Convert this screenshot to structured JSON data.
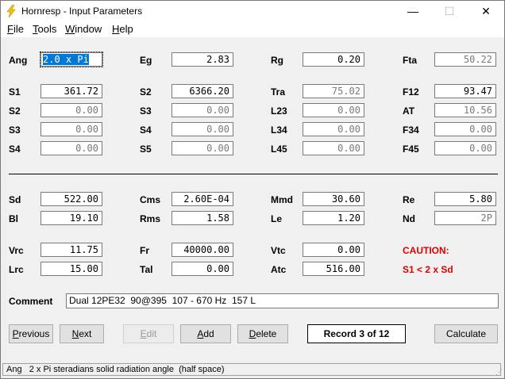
{
  "window": {
    "title": "Hornresp - Input Parameters",
    "icon": "lightning-bolt-icon",
    "controls": {
      "minimize": "—",
      "maximize": "☐",
      "close": "✕"
    }
  },
  "menu": {
    "file_first": "F",
    "file_rest": "ile",
    "tools_first": "T",
    "tools_rest": "ools",
    "window_first": "W",
    "window_rest": "indow",
    "help_first": "H",
    "help_rest": "elp"
  },
  "params": {
    "Ang": {
      "label": "Ang",
      "value": "2.0 x Pi"
    },
    "Eg": {
      "label": "Eg",
      "value": "2.83"
    },
    "Rg": {
      "label": "Rg",
      "value": "0.20"
    },
    "Fta": {
      "label": "Fta",
      "value": "50.22"
    },
    "S1": {
      "label": "S1",
      "value": "361.72"
    },
    "S2": {
      "label": "S2",
      "value": "6366.20"
    },
    "Tra": {
      "label": "Tra",
      "value": "75.02"
    },
    "F12": {
      "label": "F12",
      "value": "93.47"
    },
    "S2b": {
      "label": "S2",
      "value": "0.00"
    },
    "S3": {
      "label": "S3",
      "value": "0.00"
    },
    "L23": {
      "label": "L23",
      "value": "0.00"
    },
    "AT": {
      "label": "AT",
      "value": "10.56"
    },
    "S3b": {
      "label": "S3",
      "value": "0.00"
    },
    "S4": {
      "label": "S4",
      "value": "0.00"
    },
    "L34": {
      "label": "L34",
      "value": "0.00"
    },
    "F34": {
      "label": "F34",
      "value": "0.00"
    },
    "S4b": {
      "label": "S4",
      "value": "0.00"
    },
    "S5": {
      "label": "S5",
      "value": "0.00"
    },
    "L45": {
      "label": "L45",
      "value": "0.00"
    },
    "F45": {
      "label": "F45",
      "value": "0.00"
    },
    "Sd": {
      "label": "Sd",
      "value": "522.00"
    },
    "Cms": {
      "label": "Cms",
      "value": "2.60E-04"
    },
    "Mmd": {
      "label": "Mmd",
      "value": "30.60"
    },
    "Re": {
      "label": "Re",
      "value": "5.80"
    },
    "Bl": {
      "label": "Bl",
      "value": "19.10"
    },
    "Rms": {
      "label": "Rms",
      "value": "1.58"
    },
    "Le": {
      "label": "Le",
      "value": "1.20"
    },
    "Nd": {
      "label": "Nd",
      "value": "2P"
    },
    "Vrc": {
      "label": "Vrc",
      "value": "11.75"
    },
    "Fr": {
      "label": "Fr",
      "value": "40000.00"
    },
    "Vtc": {
      "label": "Vtc",
      "value": "0.00"
    },
    "Lrc": {
      "label": "Lrc",
      "value": "15.00"
    },
    "Tal": {
      "label": "Tal",
      "value": "0.00"
    },
    "Atc": {
      "label": "Atc",
      "value": "516.00"
    }
  },
  "caution": {
    "title": "CAUTION:",
    "message": "S1 < 2 x Sd"
  },
  "comment": {
    "label": "Comment",
    "value": "Dual 12PE32  90@395  107 - 670 Hz  157 L"
  },
  "buttons": {
    "previous_first": "P",
    "previous_rest": "revious",
    "next_first": "N",
    "next_rest": "ext",
    "edit_first": "E",
    "edit_rest": "dit",
    "add_first": "A",
    "add_rest": "dd",
    "delete_first": "D",
    "delete_rest": "elete",
    "calculate": "Calculate"
  },
  "record": "Record 3 of 12",
  "status": "Ang   2 x Pi steradians solid radiation angle  (half space)",
  "colors": {
    "caution": "#e00000",
    "selection": "#0078d7",
    "icon": "#f5c400"
  }
}
